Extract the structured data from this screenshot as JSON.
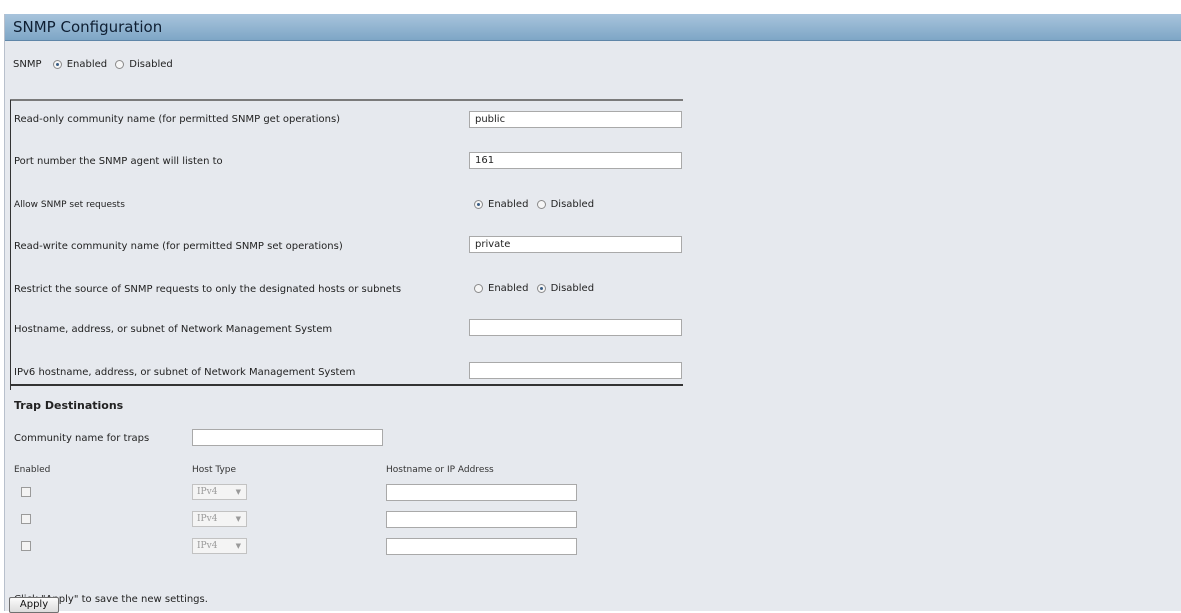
{
  "title": "SNMP Configuration",
  "snmp": {
    "label": "SNMP",
    "enabled_label": "Enabled",
    "disabled_label": "Disabled",
    "selected": "Enabled"
  },
  "fields": {
    "read_only_label": "Read-only community name (for permitted SNMP get operations)",
    "read_only_value": "public",
    "port_label": "Port number the SNMP agent will listen to",
    "port_value": "161",
    "allow_set_label": "Allow SNMP set requests",
    "allow_set_enabled": "Enabled",
    "allow_set_disabled": "Disabled",
    "allow_set_selected": "Enabled",
    "read_write_label": "Read-write community name (for permitted SNMP set operations)",
    "read_write_value": "private",
    "restrict_label": "Restrict the source of SNMP requests to only the designated hosts or subnets",
    "restrict_enabled": "Enabled",
    "restrict_disabled": "Disabled",
    "restrict_selected": "Disabled",
    "nms_label": "Hostname, address, or subnet of Network Management System",
    "nms_value": "",
    "ipv6_nms_label": "IPv6 hostname, address, or subnet of Network Management System",
    "ipv6_nms_value": ""
  },
  "traps": {
    "heading": "Trap Destinations",
    "community_label": "Community name for traps",
    "community_value": "",
    "col_enabled": "Enabled",
    "col_host_type": "Host Type",
    "col_address": "Hostname or IP Address",
    "rows": [
      {
        "enabled": false,
        "host_type": "IPv4",
        "address": ""
      },
      {
        "enabled": false,
        "host_type": "IPv4",
        "address": ""
      },
      {
        "enabled": false,
        "host_type": "IPv4",
        "address": ""
      }
    ]
  },
  "footer": {
    "hint": "Click \"Apply\" to save the new settings.",
    "apply_label": "Apply"
  }
}
